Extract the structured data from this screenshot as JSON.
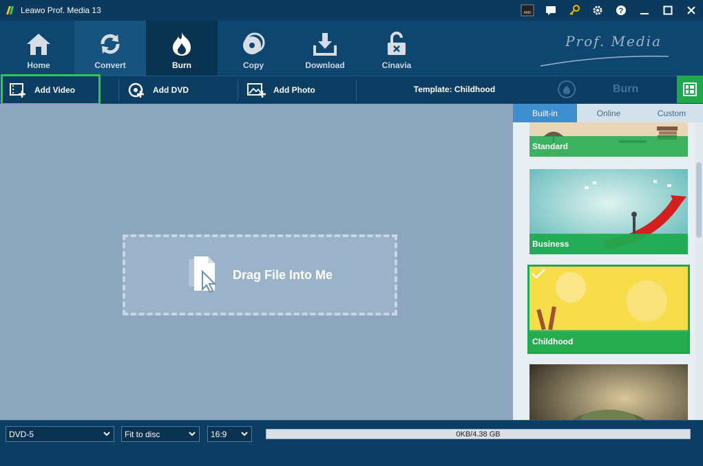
{
  "window": {
    "title": "Leawo Prof. Media 13"
  },
  "title_controls": [
    "amd-icon",
    "chat-icon",
    "key-icon",
    "gear-icon",
    "help-icon",
    "minimize-icon",
    "maximize-icon",
    "close-icon"
  ],
  "nav": {
    "items": [
      {
        "label": "Home",
        "icon": "home-icon"
      },
      {
        "label": "Convert",
        "icon": "convert-icon"
      },
      {
        "label": "Burn",
        "icon": "burn-icon"
      },
      {
        "label": "Copy",
        "icon": "copy-icon"
      },
      {
        "label": "Download",
        "icon": "download-icon"
      },
      {
        "label": "Cinavia",
        "icon": "cinavia-icon"
      }
    ],
    "active": "Burn",
    "brand": "Prof. Media"
  },
  "toolbar": {
    "add_video": "Add Video",
    "add_dvd": "Add DVD",
    "add_photo": "Add Photo",
    "template": "Template: Childhood",
    "burn": "Burn"
  },
  "dropzone": {
    "text": "Drag File Into Me"
  },
  "template_panel": {
    "tabs": [
      "Built-in",
      "Online",
      "Custom"
    ],
    "active_tab": "Built-in",
    "templates": [
      {
        "name": "Standard"
      },
      {
        "name": "Business"
      },
      {
        "name": "Childhood",
        "selected": true
      },
      {
        "name": ""
      }
    ]
  },
  "bottom": {
    "disc_type": "DVD-5",
    "fit_mode": "Fit to disc",
    "aspect": "16:9",
    "capacity": "0KB/4.38 GB"
  },
  "colors": {
    "accent_green": "#1fa84e",
    "nav_bg": "#0f4670",
    "work_bg": "#8ca6bd"
  }
}
